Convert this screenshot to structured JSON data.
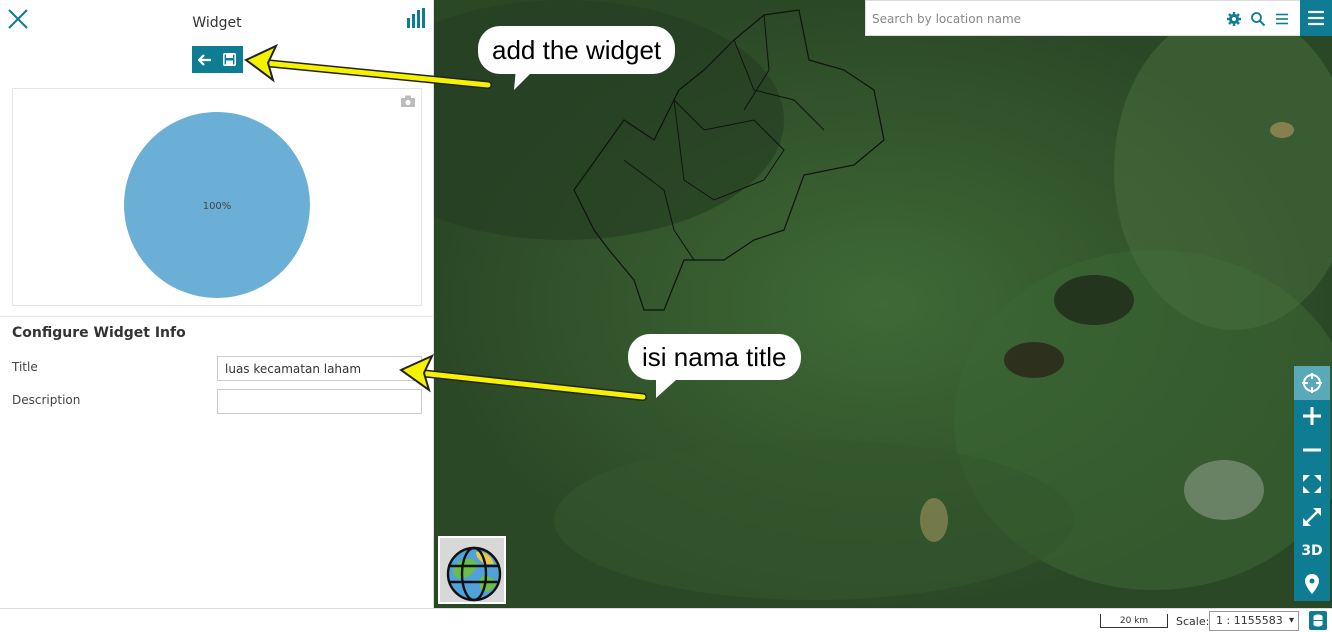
{
  "panel": {
    "title": "Widget",
    "config_title": "Configure Widget Info",
    "title_label": "Title",
    "title_value": "luas kecamatan laham",
    "description_label": "Description",
    "description_value": ""
  },
  "chart_data": {
    "type": "pie",
    "slices": [
      {
        "label": "100%",
        "value": 100,
        "color": "#6baed6"
      }
    ]
  },
  "search": {
    "placeholder": "Search by location name"
  },
  "map_tools": [
    "locate",
    "zoom-in",
    "zoom-out",
    "full-extent",
    "fullscreen",
    "3D",
    "place"
  ],
  "map_tool_3d_label": "3D",
  "annotations": {
    "bubble1": "add the widget",
    "bubble2": "isi nama title"
  },
  "bottom": {
    "scalebar_label": "20 km",
    "scale_label": "Scale:",
    "scale_value": "1 : 1155583"
  },
  "colors": {
    "accent": "#0e7c93",
    "arrow": "#f5f200"
  }
}
